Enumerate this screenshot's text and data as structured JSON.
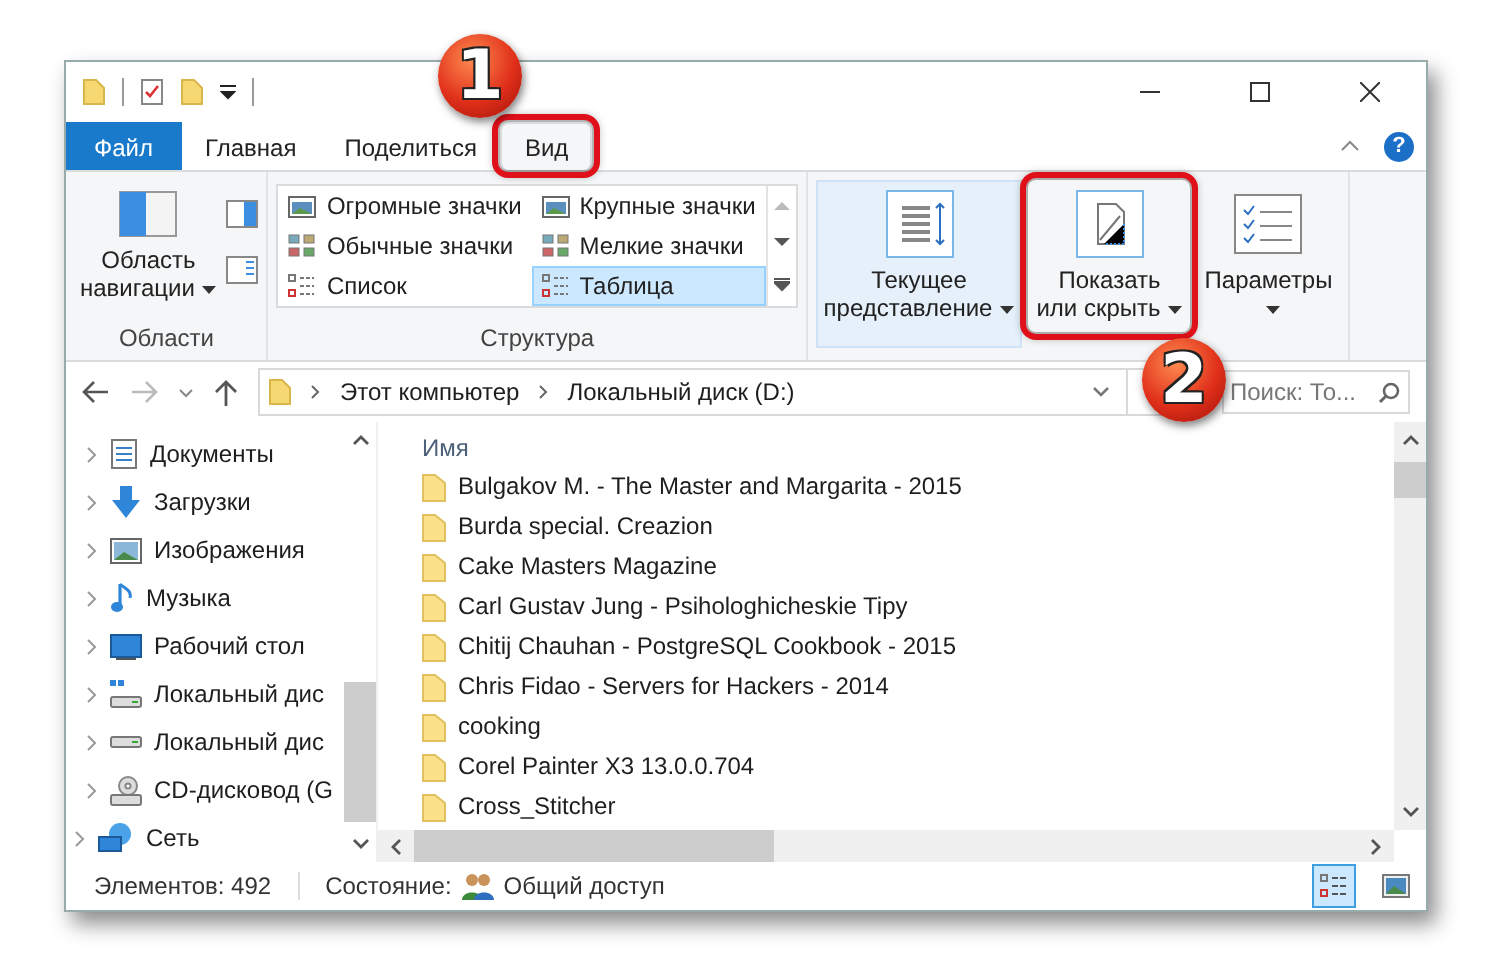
{
  "tabs": [
    {
      "label": "Файл",
      "kind": "file",
      "selected": false
    },
    {
      "label": "Главная",
      "kind": "tab",
      "selected": false
    },
    {
      "label": "Поделиться",
      "kind": "tab",
      "selected": false
    },
    {
      "label": "Вид",
      "kind": "tab",
      "selected": true,
      "highlighted": true
    }
  ],
  "help": "?",
  "ribbon": {
    "panes": {
      "label": "Области",
      "button": [
        "Область",
        "навигации"
      ]
    },
    "layout": {
      "label": "Структура",
      "items": [
        {
          "label": "Огромные значки",
          "kind": "huge",
          "selected": false
        },
        {
          "label": "Крупные значки",
          "kind": "large",
          "selected": false
        },
        {
          "label": "Обычные значки",
          "kind": "medium",
          "selected": false
        },
        {
          "label": "Мелкие значки",
          "kind": "small",
          "selected": false
        },
        {
          "label": "Список",
          "kind": "list",
          "selected": false
        },
        {
          "label": "Таблица",
          "kind": "details",
          "selected": true
        }
      ]
    },
    "buttons": [
      {
        "kind": "current_view",
        "lines": [
          "Текущее",
          "представление"
        ]
      },
      {
        "kind": "show_hide",
        "lines": [
          "Показать",
          "или скрыть"
        ],
        "highlighted": true
      },
      {
        "kind": "options",
        "lines": [
          "Параметры"
        ]
      }
    ]
  },
  "address": {
    "crumbs": [
      "Этот компьютер",
      "Локальный диск (D:)"
    ]
  },
  "search": {
    "placeholder": "Поиск: То..."
  },
  "nav_pane": {
    "items": [
      {
        "label": "Документы",
        "kind": "documents"
      },
      {
        "label": "Загрузки",
        "kind": "downloads"
      },
      {
        "label": "Изображения",
        "kind": "pictures"
      },
      {
        "label": "Музыка",
        "kind": "music"
      },
      {
        "label": "Рабочий стол",
        "kind": "desktop"
      },
      {
        "label": "Локальный дис",
        "kind": "system_drive"
      },
      {
        "label": "Локальный дис",
        "kind": "drive"
      },
      {
        "label": "CD-дисковод (G",
        "kind": "cd"
      },
      {
        "label": "Сеть",
        "kind": "network"
      }
    ]
  },
  "file_list": {
    "column": "Имя",
    "rows": [
      "Bulgakov M. - The Master and Margarita  - 2015",
      "Burda special. Creazion",
      "Cake Masters Magazine",
      "Carl Gustav Jung - Psihologhicheskie Tipy",
      "Chitij Chauhan - PostgreSQL Cookbook - 2015",
      "Chris Fidao - Servers for Hackers - 2014",
      "cooking",
      "Corel Painter X3 13.0.0.704",
      "Cross_Stitcher"
    ]
  },
  "status_bar": {
    "items_count": "Элементов: 492",
    "state_label": "Состояние:",
    "state_value": "Общий доступ",
    "views": [
      {
        "kind": "details",
        "selected": true
      },
      {
        "kind": "tiles",
        "selected": false
      }
    ]
  },
  "annotations": [
    {
      "number": "1"
    },
    {
      "number": "2"
    }
  ]
}
